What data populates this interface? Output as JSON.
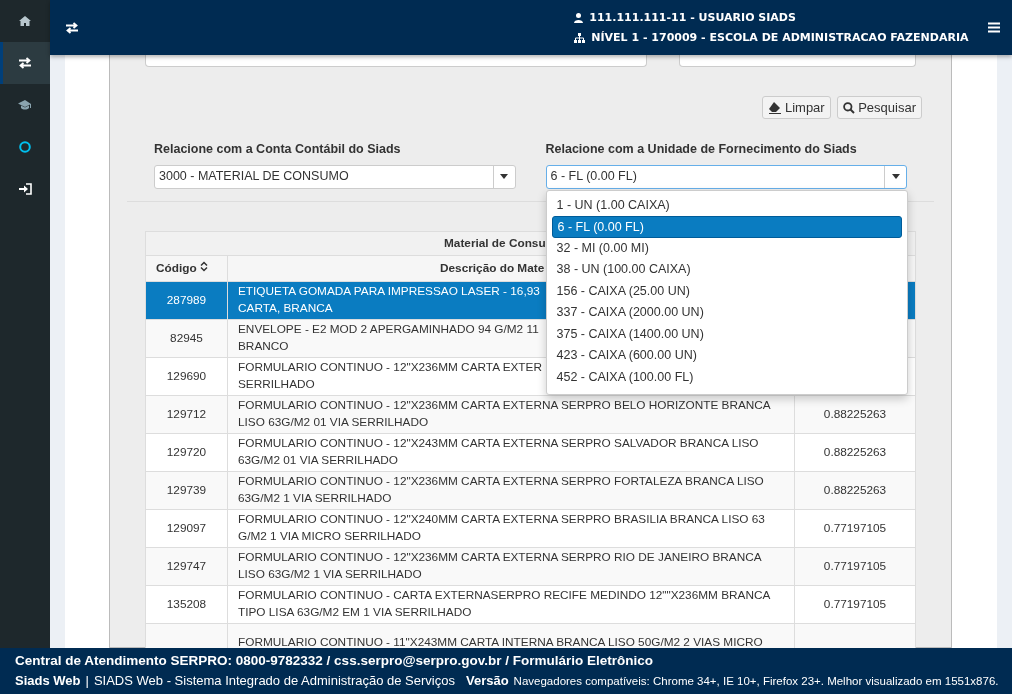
{
  "sidebar": {
    "items": [
      {
        "kind": "home",
        "selected": false
      },
      {
        "kind": "transfer",
        "selected": true
      },
      {
        "kind": "course",
        "selected": false
      },
      {
        "kind": "status",
        "selected": false
      },
      {
        "kind": "login",
        "selected": false
      }
    ]
  },
  "header": {
    "user": "111.111.111-11 - USUARIO SIADS",
    "unit": "NÍVEL 1 - 170009 - ESCOLA DE ADMINISTRACAO FAZENDARIA"
  },
  "buttons": [
    {
      "kind": "clear",
      "label": "Limpar"
    },
    {
      "kind": "search",
      "label": "Pesquisar"
    }
  ],
  "filters": [
    {
      "label": "Relacione com a Conta Contábil do Siads",
      "value": "3000 - MATERIAL DE CONSUMO",
      "expanded": false
    },
    {
      "label": "Relacione com a Unidade de Fornecimento do Siads",
      "value": "6 - FL (0.00 FL)",
      "expanded": true,
      "options": [
        {
          "label": "1 - UN (1.00 CAIXA)",
          "selected": false
        },
        {
          "label": "6 - FL (0.00 FL)",
          "selected": true
        },
        {
          "label": "32 - MI (0.00 MI)",
          "selected": false
        },
        {
          "label": "38 - UN (100.00 CAIXA)",
          "selected": false
        },
        {
          "label": "156 - CAIXA (25.00 UN)",
          "selected": false
        },
        {
          "label": "337 - CAIXA (2000.00 UN)",
          "selected": false
        },
        {
          "label": "375 - CAIXA (1400.00 UN)",
          "selected": false
        },
        {
          "label": "423 - CAIXA (600.00 UN)",
          "selected": false
        },
        {
          "label": "452 - CAIXA (100.00 FL)",
          "selected": false
        }
      ]
    }
  ],
  "table": {
    "caption": "Material de Consu",
    "columns": [
      "Código",
      "Descrição do Mate"
    ],
    "rows": [
      {
        "code": "287989",
        "description": "ETIQUETA GOMADA PARA IMPRESSAO LASER - 16,93\nCARTA, BRANCA",
        "selected": true
      },
      {
        "code": "82945",
        "description": "ENVELOPE - E2 MOD 2 APERGAMINHADO 94 G/M2 11\nBRANCO",
        "selected": false
      },
      {
        "code": "129690",
        "description": "FORMULARIO CONTINUO - 12\"X236MM CARTA EXTER\nSERRILHADO",
        "selected": false
      },
      {
        "code": "129712",
        "description": "FORMULARIO CONTINUO - 12\"X236MM CARTA EXTERNA SERPRO BELO HORIZONTE BRANCA LISO 63G/M2 01 VIA SERRILHADO",
        "value": "0.88225263",
        "selected": false
      },
      {
        "code": "129720",
        "description": "FORMULARIO CONTINUO - 12\"X243MM CARTA EXTERNA SERPRO SALVADOR BRANCA LISO 63G/M2 01 VIA SERRILHADO",
        "value": "0.88225263",
        "selected": false
      },
      {
        "code": "129739",
        "description": "FORMULARIO CONTINUO - 12\"X236MM CARTA EXTERNA SERPRO FORTALEZA BRANCA LISO 63G/M2 1 VIA SERRILHADO",
        "value": "0.88225263",
        "selected": false
      },
      {
        "code": "129097",
        "description": "FORMULARIO CONTINUO - 12\"X240MM CARTA EXTERNA SERPRO BRASILIA BRANCA LISO 63 G/M2 1 VIA MICRO SERRILHADO",
        "value": "0.77197105",
        "selected": false
      },
      {
        "code": "129747",
        "description": "FORMULARIO CONTINUO - 12\"X236MM CARTA EXTERNA SERPRO RIO DE JANEIRO BRANCA LISO 63G/M2 1 VIA SERRILHADO",
        "value": "0.77197105",
        "selected": false
      },
      {
        "code": "135208",
        "description": "FORMULARIO CONTINUO - CARTA EXTERNASERPRO RECIFE MEDINDO 12\"\"X236MM BRANCA TIPO LISA 63G/M2 EM 1 VIA SERRILHADO",
        "value": "0.77197105",
        "selected": false
      },
      {
        "description": "FORMULARIO CONTINUO - 11\"X243MM CARTA INTERNA BRANCA LISO 50G/M2 2 VIAS MICRO",
        "selected": false
      }
    ]
  },
  "footer": {
    "contact": "Central de Atendimento SERPRO: 0800-9782332 / css.serpro@serpro.gov.br / Formulário Eletrônico",
    "brand": "Siads Web",
    "separator": "|",
    "system": "SIADS Web - Sistema Integrado de Administração de Serviços",
    "version_label": "Versão",
    "browsers": "Navegadores compatíveis: Chrome 34+, IE 10+, Firefox 23+. Melhor visualizado em 1551x876."
  }
}
